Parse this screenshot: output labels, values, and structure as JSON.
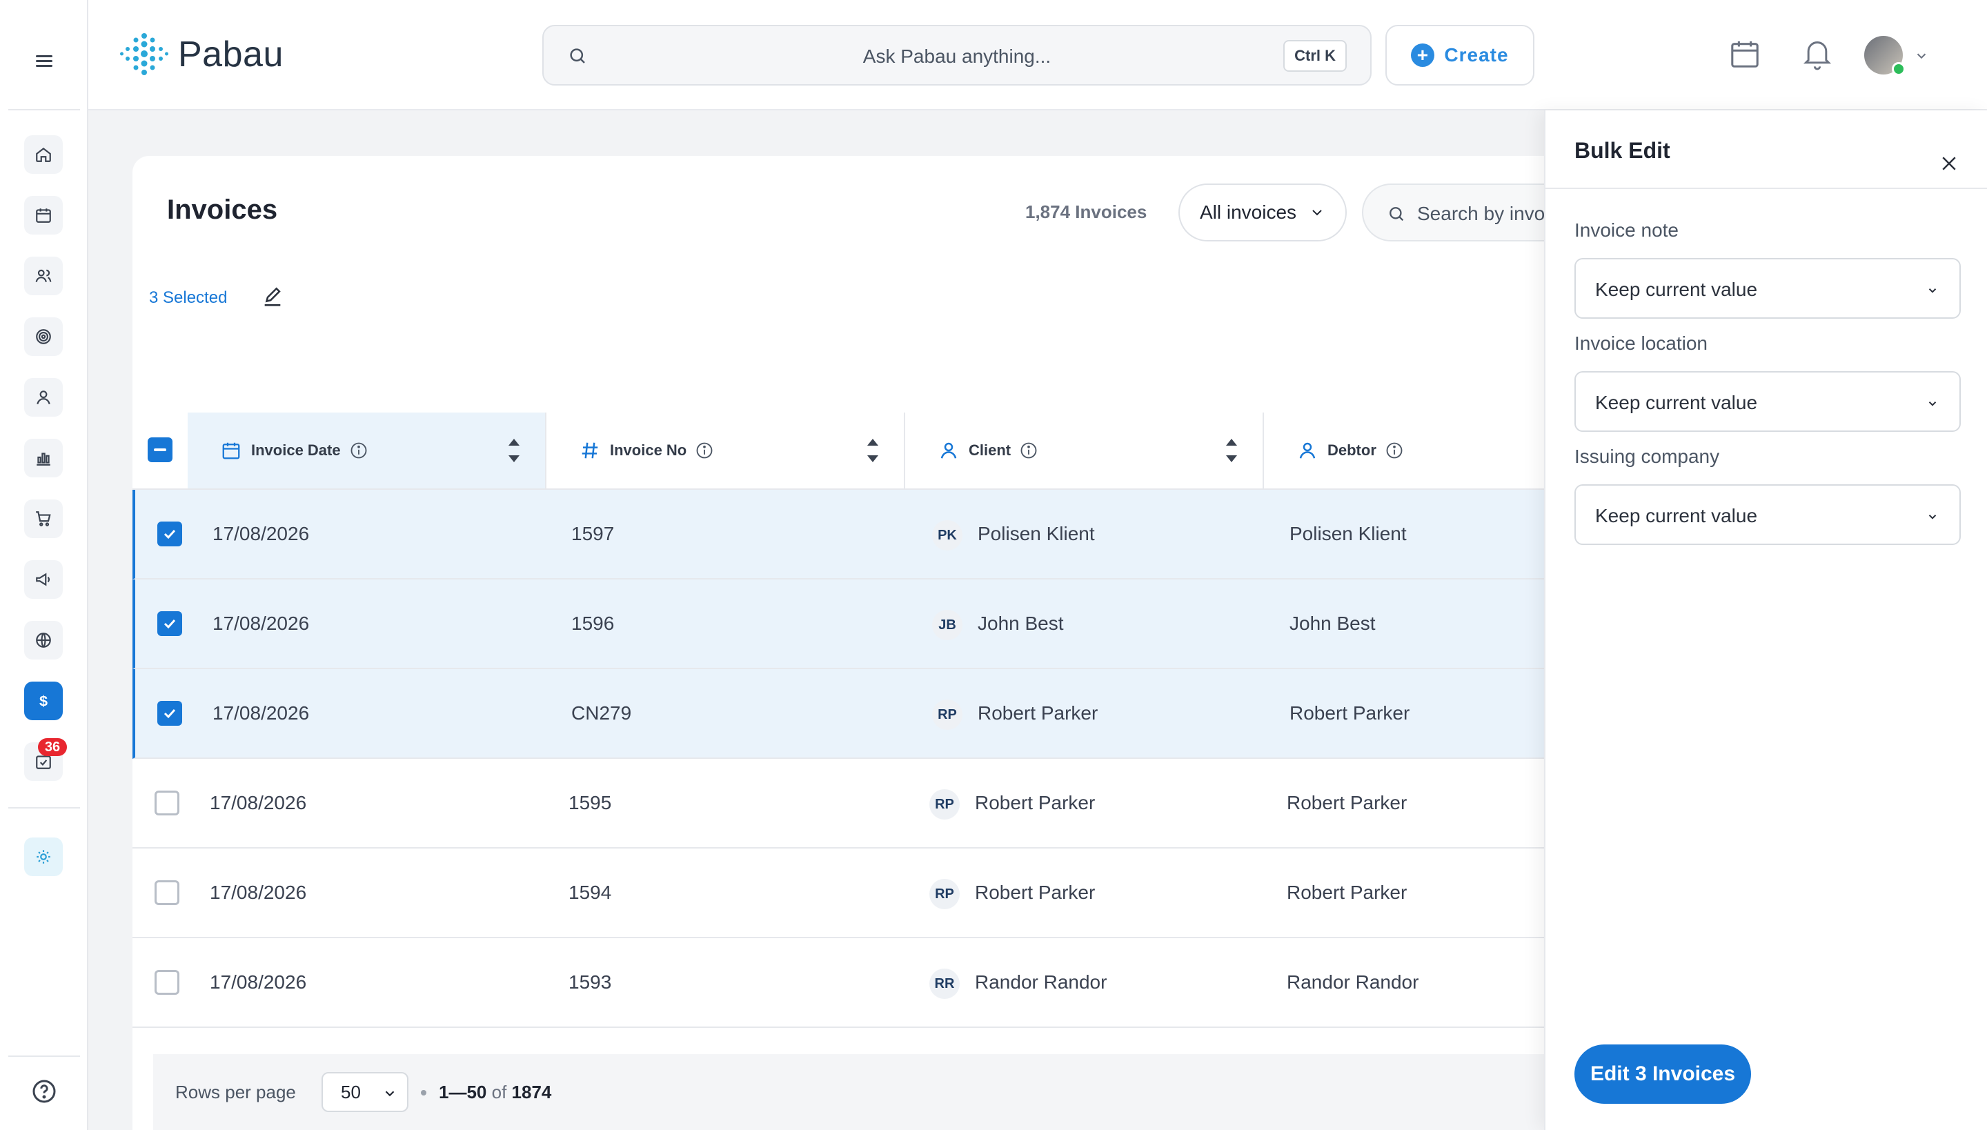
{
  "app": {
    "logo_text": "Pabau",
    "search_placeholder": "Ask Pabau anything...",
    "search_shortcut": "Ctrl K",
    "create_label": "Create",
    "notifications_badge": "36",
    "brand_color": "#1777d6",
    "accent_color": "#2a8be0"
  },
  "sidebar": {
    "items": [
      {
        "name": "home-icon"
      },
      {
        "name": "calendar-icon"
      },
      {
        "name": "clients-icon"
      },
      {
        "name": "target-icon"
      },
      {
        "name": "user-icon"
      },
      {
        "name": "reports-icon"
      },
      {
        "name": "cart-icon"
      },
      {
        "name": "megaphone-icon"
      },
      {
        "name": "globe-icon"
      },
      {
        "name": "dollar-icon",
        "active": true
      },
      {
        "name": "tasks-icon",
        "badge": "36"
      },
      {
        "name": "settings-sun-icon"
      }
    ]
  },
  "main": {
    "title": "Invoices",
    "count_label": "1,874 Invoices",
    "filter_label": "All invoices",
    "search_placeholder": "Search by invoi",
    "selected_label": "3 Selected",
    "columns": [
      "Invoice Date",
      "Invoice No",
      "Client",
      "Debtor"
    ],
    "rows": [
      {
        "date": "17/08/2026",
        "no": "1597",
        "initials": "PK",
        "client": "Polisen Klient",
        "debtor": "Polisen Klient",
        "selected": true
      },
      {
        "date": "17/08/2026",
        "no": "1596",
        "initials": "JB",
        "client": "John Best",
        "debtor": "John Best",
        "selected": true
      },
      {
        "date": "17/08/2026",
        "no": "CN279",
        "initials": "RP",
        "client": "Robert Parker",
        "debtor": "Robert Parker",
        "selected": true
      },
      {
        "date": "17/08/2026",
        "no": "1595",
        "initials": "RP",
        "client": "Robert Parker",
        "debtor": "Robert Parker",
        "selected": false
      },
      {
        "date": "17/08/2026",
        "no": "1594",
        "initials": "RP",
        "client": "Robert Parker",
        "debtor": "Robert Parker",
        "selected": false
      },
      {
        "date": "17/08/2026",
        "no": "1593",
        "initials": "RR",
        "client": "Randor Randor",
        "debtor": "Randor Randor",
        "selected": false
      }
    ],
    "footer": {
      "rows_per_page_label": "Rows per page",
      "rows_per_page_value": "50",
      "range": "1—50",
      "of": "of",
      "total": "1874"
    }
  },
  "bulk_edit": {
    "title": "Bulk Edit",
    "fields": [
      {
        "label": "Invoice note",
        "value": "Keep current value"
      },
      {
        "label": "Invoice location",
        "value": "Keep current value"
      },
      {
        "label": "Issuing company",
        "value": "Keep current value"
      }
    ],
    "submit_label": "Edit 3 Invoices"
  }
}
